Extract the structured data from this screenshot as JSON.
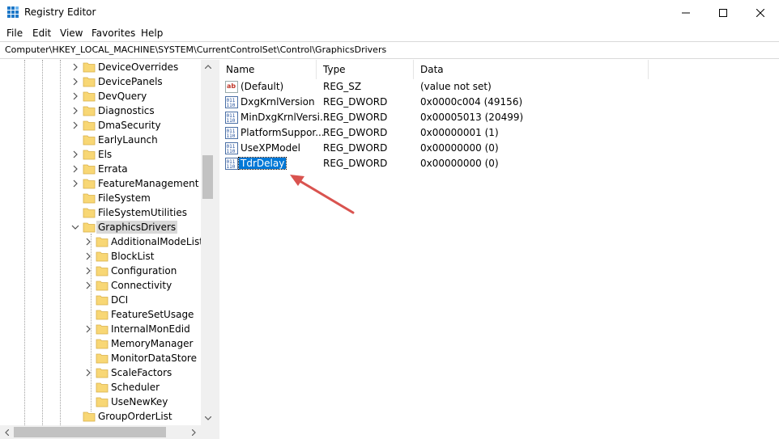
{
  "window": {
    "title": "Registry Editor"
  },
  "menu": [
    "File",
    "Edit",
    "View",
    "Favorites",
    "Help"
  ],
  "address": "Computer\\HKEY_LOCAL_MACHINE\\SYSTEM\\CurrentControlSet\\Control\\GraphicsDrivers",
  "tree": {
    "items": [
      {
        "label": "DeviceOverrides",
        "expandable": true
      },
      {
        "label": "DevicePanels",
        "expandable": true
      },
      {
        "label": "DevQuery",
        "expandable": true
      },
      {
        "label": "Diagnostics",
        "expandable": true
      },
      {
        "label": "DmaSecurity",
        "expandable": true
      },
      {
        "label": "EarlyLaunch",
        "expandable": false
      },
      {
        "label": "Els",
        "expandable": true
      },
      {
        "label": "Errata",
        "expandable": true
      },
      {
        "label": "FeatureManagement",
        "expandable": true
      },
      {
        "label": "FileSystem",
        "expandable": false
      },
      {
        "label": "FileSystemUtilities",
        "expandable": false
      },
      {
        "label": "GraphicsDrivers",
        "expandable": true,
        "expanded": true,
        "selected": true
      },
      {
        "label": "AdditionalModeLists",
        "expandable": true,
        "child": true
      },
      {
        "label": "BlockList",
        "expandable": true,
        "child": true
      },
      {
        "label": "Configuration",
        "expandable": true,
        "child": true
      },
      {
        "label": "Connectivity",
        "expandable": true,
        "child": true
      },
      {
        "label": "DCI",
        "expandable": false,
        "child": true
      },
      {
        "label": "FeatureSetUsage",
        "expandable": false,
        "child": true
      },
      {
        "label": "InternalMonEdid",
        "expandable": true,
        "child": true
      },
      {
        "label": "MemoryManager",
        "expandable": false,
        "child": true
      },
      {
        "label": "MonitorDataStore",
        "expandable": false,
        "child": true
      },
      {
        "label": "ScaleFactors",
        "expandable": true,
        "child": true
      },
      {
        "label": "Scheduler",
        "expandable": false,
        "child": true
      },
      {
        "label": "UseNewKey",
        "expandable": false,
        "child": true
      },
      {
        "label": "GroupOrderList",
        "expandable": false
      }
    ]
  },
  "values": {
    "columns": {
      "name": "Name",
      "type": "Type",
      "data": "Data"
    },
    "rows": [
      {
        "icon": "string-value-icon",
        "name": "(Default)",
        "type": "REG_SZ",
        "data": "(value not set)"
      },
      {
        "icon": "binary-value-icon",
        "name": "DxgKrnlVersion",
        "type": "REG_DWORD",
        "data": "0x0000c004 (49156)"
      },
      {
        "icon": "binary-value-icon",
        "name": "MinDxgKrnlVersi...",
        "type": "REG_DWORD",
        "data": "0x00005013 (20499)"
      },
      {
        "icon": "binary-value-icon",
        "name": "PlatformSuppor...",
        "type": "REG_DWORD",
        "data": "0x00000001 (1)"
      },
      {
        "icon": "binary-value-icon",
        "name": "UseXPModel",
        "type": "REG_DWORD",
        "data": "0x00000000 (0)"
      },
      {
        "icon": "binary-value-icon",
        "name": "TdrDelay",
        "type": "REG_DWORD",
        "data": "0x00000000 (0)",
        "selected": true
      }
    ]
  },
  "colors": {
    "selection": "#0078d7",
    "annotation_arrow": "#d9534f",
    "folder": "#f8d775"
  }
}
